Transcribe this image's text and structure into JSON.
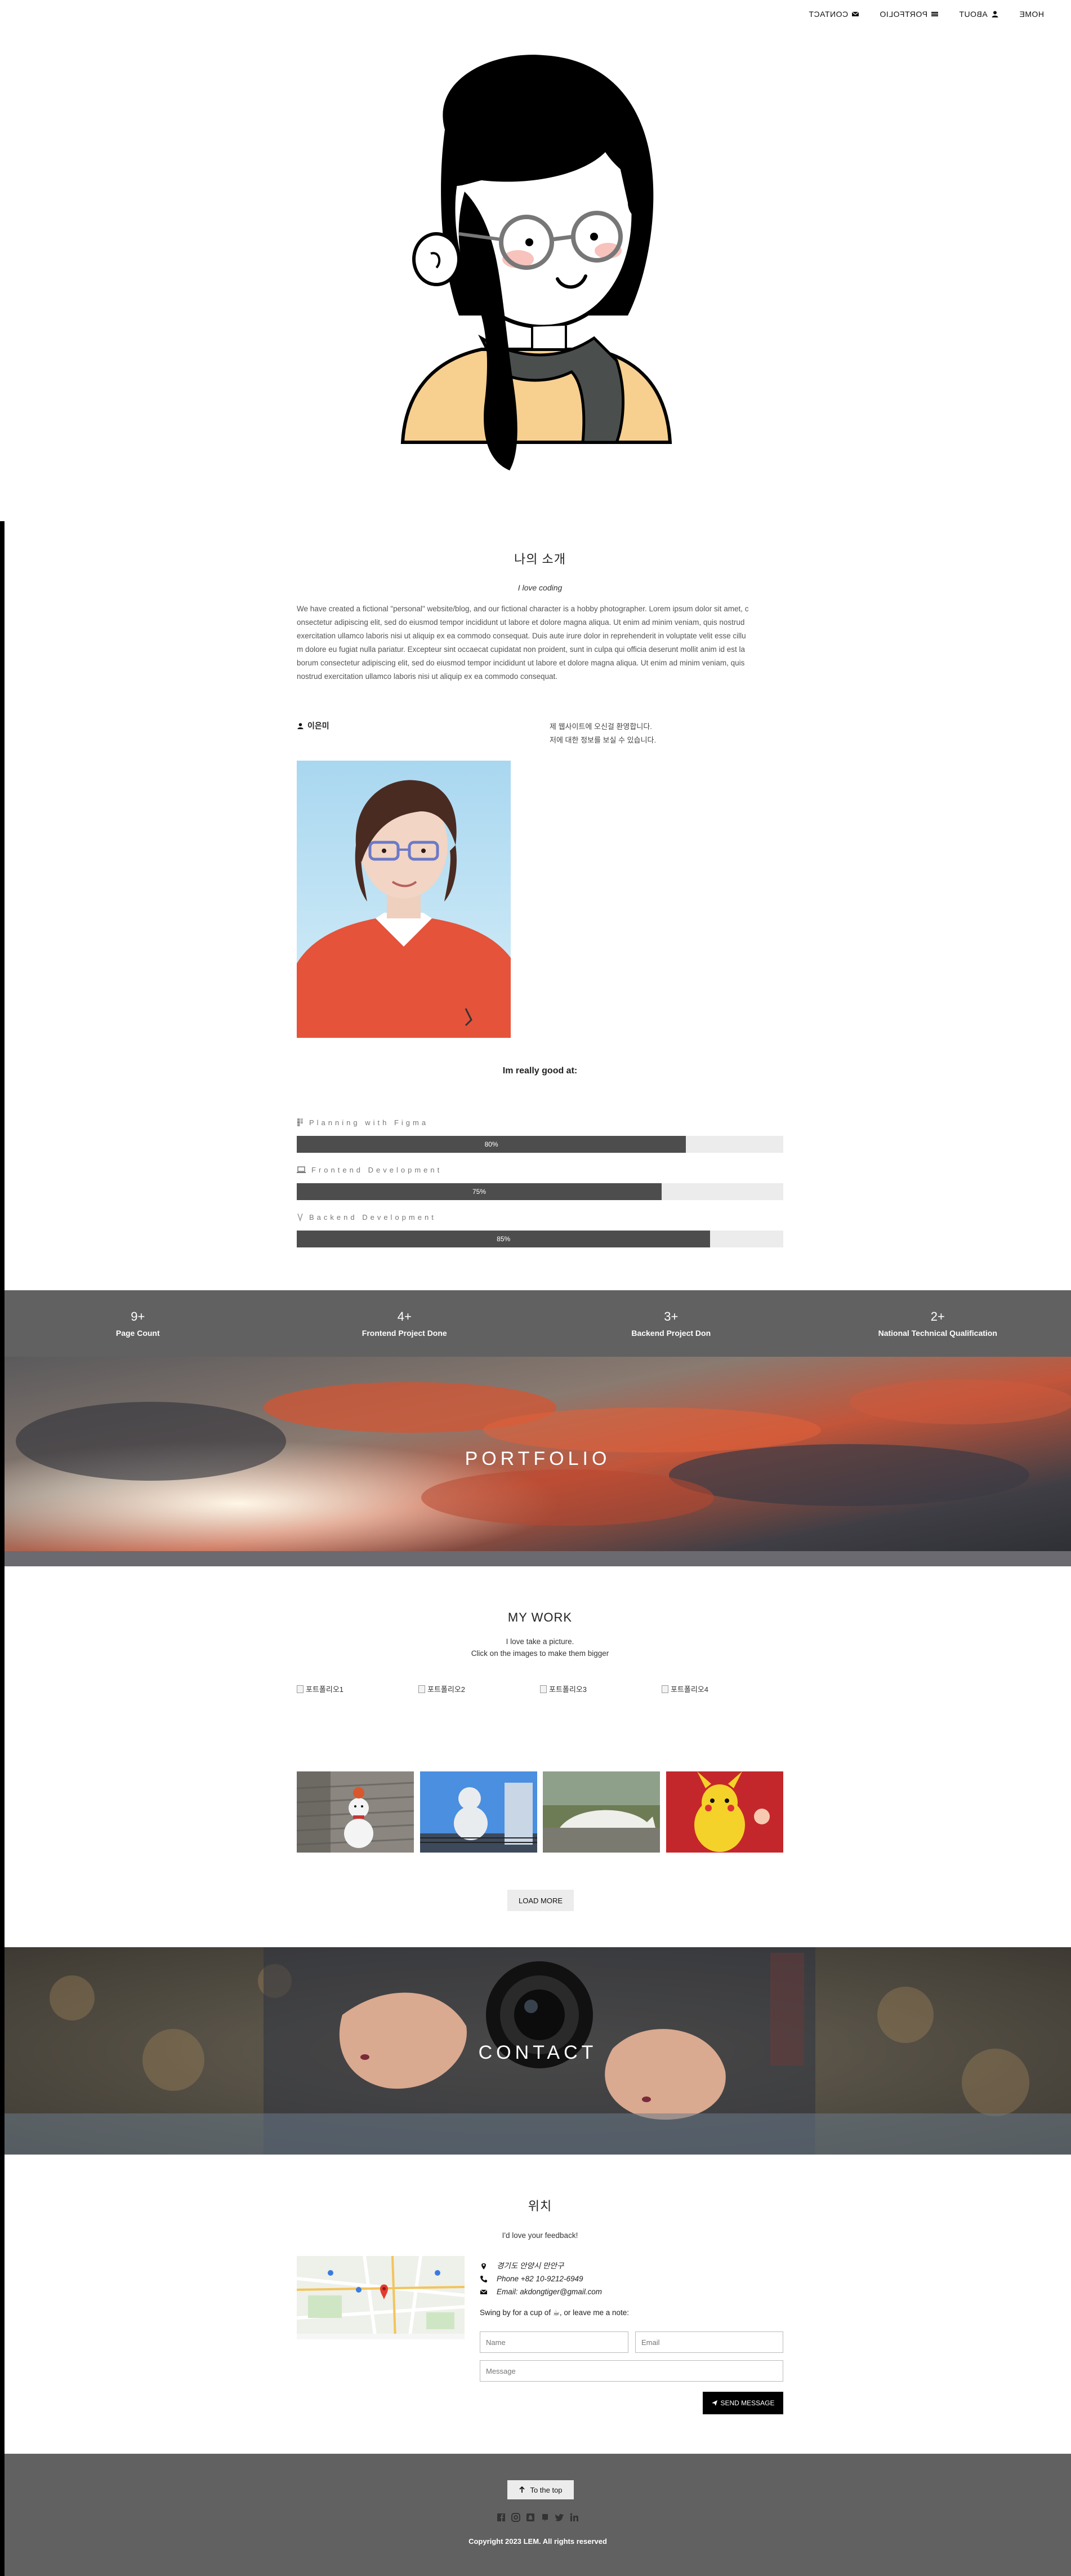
{
  "nav": {
    "items": [
      {
        "label": "CONTACT",
        "icon": "envelope-icon"
      },
      {
        "label": "PORTFOLIO",
        "icon": "grid-icon"
      },
      {
        "label": "ABOUT",
        "icon": "user-icon"
      },
      {
        "label": "HOME",
        "icon": ""
      }
    ]
  },
  "about": {
    "title": "나의 소개",
    "subtitle": "I love coding",
    "paragraph": [
      "We have created a fictional \"personal\" website/blog, and our fictional character is a hobby photographer. Lorem ipsum dolor sit amet, c",
      "onsectetur adipiscing elit, sed do eiusmod tempor incididunt ut labore et dolore magna aliqua. Ut enim ad minim veniam, quis nostrud",
      "exercitation ullamco laboris nisi ut aliquip ex ea commodo consequat. Duis aute irure dolor in reprehenderit in voluptate velit esse cillu",
      "m dolore eu fugiat nulla pariatur. Excepteur sint occaecat cupidatat non proident, sunt in culpa qui officia deserunt mollit anim id est la",
      "borum consectetur adipiscing elit, sed do eiusmod tempor incididunt ut labore et dolore magna aliqua. Ut enim ad minim veniam, quis",
      "nostrud exercitation ullamco laboris nisi ut aliquip ex ea commodo consequat."
    ],
    "name": "이은미",
    "side_text": [
      "제 웹사이트에 오신걸 환영합니다.",
      "저에 대한 정보를 보실 수 있습니다."
    ]
  },
  "skills": {
    "heading": "Im really good at:",
    "items": [
      {
        "label": "Planning with Figma",
        "icon": "figma-icon",
        "percent": 80,
        "percent_label": "80%"
      },
      {
        "label": "Frontend Development",
        "icon": "laptop-icon",
        "percent": 75,
        "percent_label": "75%"
      },
      {
        "label": "Backend Development",
        "icon": "database-icon",
        "percent": 85,
        "percent_label": "85%"
      }
    ]
  },
  "stats": [
    {
      "value": "9+",
      "label": "Page Count"
    },
    {
      "value": "4+",
      "label": "Frontend Project Done"
    },
    {
      "value": "3+",
      "label": "Backend Project Don"
    },
    {
      "value": "2+",
      "label": "National Technical Qualification"
    }
  ],
  "portfolio": {
    "banner_title": "PORTFOLIO",
    "title": "MY WORK",
    "line1": "I love take a picture.",
    "line2": "Click on the images to make them bigger",
    "broken_images": [
      "포트폴리오1",
      "포트폴리오2",
      "포트폴리오3",
      "포트폴리오4"
    ],
    "load_more": "LOAD MORE"
  },
  "contact": {
    "banner_title": "CONTACT",
    "title": "위치",
    "subtitle": "I'd love your feedback!",
    "address": "경기도 안양시 만안구",
    "phone": "Phone +82 10-9212-6949",
    "email": "Email: akdongtiger@gmail.com",
    "note": "Swing by for a cup of ☕, or leave me a note:",
    "name_placeholder": "Name",
    "email_placeholder": "Email",
    "message_placeholder": "Message",
    "send_label": "SEND MESSAGE"
  },
  "footer": {
    "top_button": "To the top",
    "copyright": "Copyright 2023 LEM. All rights reserved"
  },
  "colors": {
    "stats_bg": "#616161",
    "skill_fill": "#4d4d4d",
    "skill_track": "#ececec",
    "footer_bg": "#616161"
  }
}
